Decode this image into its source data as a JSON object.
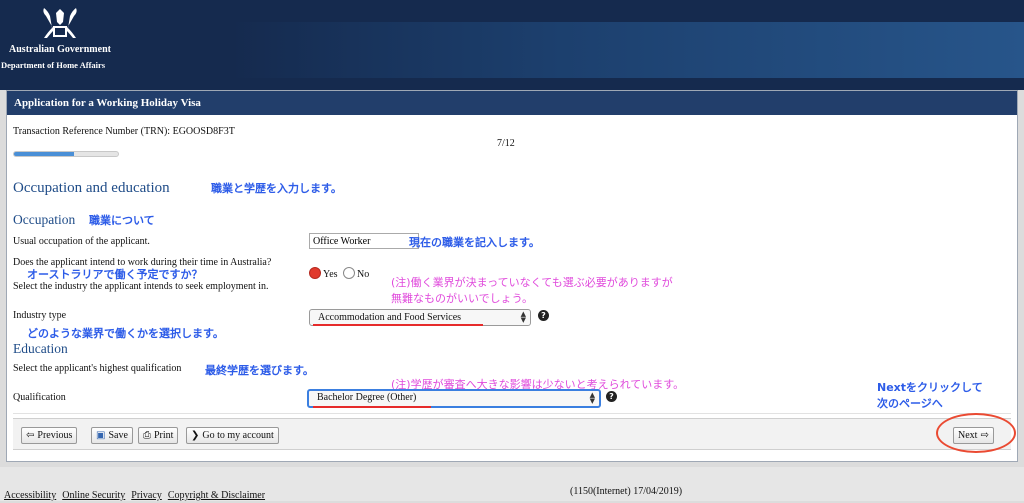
{
  "header": {
    "gov_name": "Australian Government",
    "dept_name": "Department of Home Affairs"
  },
  "panel": {
    "title": "Application for a Working Holiday Visa",
    "trn": "Transaction Reference Number (TRN): EGOOSD8F3T",
    "step": "7/12",
    "progress_fraction": 0.58
  },
  "sections": {
    "main_heading": "Occupation and education",
    "occupation_heading": "Occupation",
    "education_heading": "Education"
  },
  "fields": {
    "usual_occupation_label": "Usual occupation of the applicant.",
    "usual_occupation_value": "Office Worker",
    "intend_work_label": "Does the applicant intend to work during their time in Australia?",
    "radio_yes": "Yes",
    "radio_no": "No",
    "select_industry_label": "Select the industry the applicant intends to seek employment in.",
    "industry_type_label": "Industry type",
    "industry_type_value": "Accommodation and Food Services",
    "highest_qual_label": "Select the applicant's highest qualification",
    "qualification_label": "Qualification",
    "qualification_value": "Bachelor Degree (Other)"
  },
  "annotations": {
    "main": "職業と学歴を入力します。",
    "occupation": "職業について",
    "usual_occupation": "現在の職業を記入します。",
    "intend_work": "オーストラリアで働く予定ですか？",
    "industry_note_1": "(注)働く業界が決まっていなくても選ぶ必要がありますが",
    "industry_note_2": "無難なものがいいでしょう。",
    "industry_type": "どのような業界で働くかを選択します。",
    "highest_qual": "最終学歴を選びます。",
    "qual_note": "(注)学歴が審査へ大きな影響は少ないと考えられています。",
    "next_1": "Nextをクリックして",
    "next_2": "次のページへ"
  },
  "buttons": {
    "previous": "Previous",
    "save": "Save",
    "print": "Print",
    "go_account": "Go to my account",
    "next": "Next"
  },
  "footer": {
    "links": [
      "Accessibility",
      "Online Security",
      "Privacy",
      "Copyright & Disclaimer"
    ],
    "version": "(1150(Internet) 17/04/2019)"
  },
  "colors": {
    "header_bg": "#152a4e",
    "panel_title_bg": "#223e6b",
    "heading_blue": "#1f4c88",
    "annotation_blue": "#2d5ce8",
    "annotation_pink": "#e04bdc",
    "highlight_red": "#e62b2b"
  }
}
